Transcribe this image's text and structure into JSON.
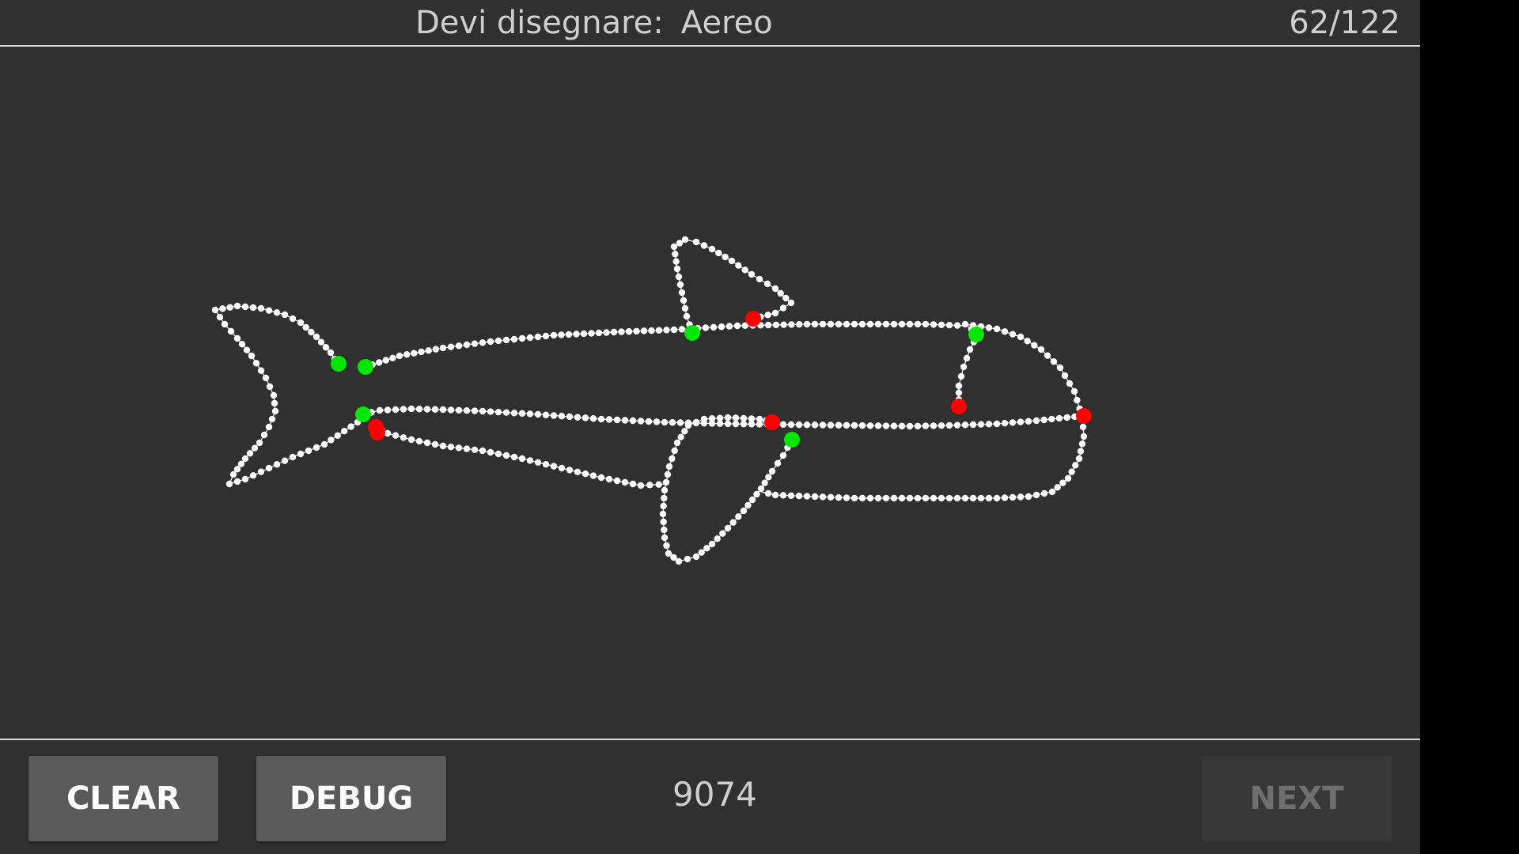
{
  "header": {
    "prompt_label": "Devi disegnare:",
    "target_word": "Aereo",
    "progress": "62/122"
  },
  "canvas": {
    "stroke_color": "#ffffff",
    "start_point_color": "#00e600",
    "end_point_color": "#ff0000",
    "strokes_drawn": 9
  },
  "footer": {
    "clear_label": "CLEAR",
    "debug_label": "DEBUG",
    "score": "9074",
    "next_label": "NEXT",
    "next_enabled": false
  },
  "colors": {
    "background": "#303030",
    "button": "#5a5a5b",
    "button_disabled": "#383838",
    "text": "#cfcfcf"
  }
}
